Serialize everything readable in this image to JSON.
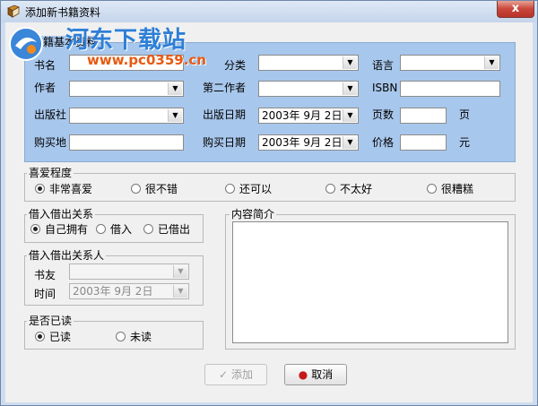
{
  "window": {
    "title": "添加新书籍资料",
    "close_label": "x"
  },
  "watermark": {
    "name": "河东下载站",
    "url": "www.pc0359.cn"
  },
  "basic_info": {
    "title": "书籍基本资料",
    "book_name_label": "书名",
    "category_label": "分类",
    "language_label": "语言",
    "author_label": "作者",
    "second_author_label": "第二作者",
    "isbn_label": "ISBN",
    "publisher_label": "出版社",
    "publish_date_label": "出版日期",
    "publish_date_value": "2003年 9月 2日",
    "pages_label": "页数",
    "pages_unit": "页",
    "purchase_place_label": "购买地",
    "purchase_date_label": "购买日期",
    "purchase_date_value": "2003年 9月 2日",
    "price_label": "价格",
    "price_unit": "元"
  },
  "preference": {
    "title": "喜爱程度",
    "options": [
      "非常喜爱",
      "很不错",
      "还可以",
      "不太好",
      "很糟糕"
    ],
    "selected": 0
  },
  "lending": {
    "title": "借入借出关系",
    "options": [
      "自己拥有",
      "借入",
      "已借出"
    ],
    "selected": 0
  },
  "lending_person": {
    "title": "借入借出关系人",
    "friend_label": "书友",
    "time_label": "时间",
    "time_value": "2003年 9月 2日"
  },
  "read_status": {
    "title": "是否已读",
    "options": [
      "已读",
      "未读"
    ],
    "selected": 0
  },
  "summary": {
    "title": "内容简介"
  },
  "buttons": {
    "add_label": "添加",
    "cancel_label": "取消"
  },
  "colors": {
    "basic_panel_bg": "#a8c7ec",
    "title_bar": "#c4d4ea",
    "close_button": "#c8463a"
  }
}
